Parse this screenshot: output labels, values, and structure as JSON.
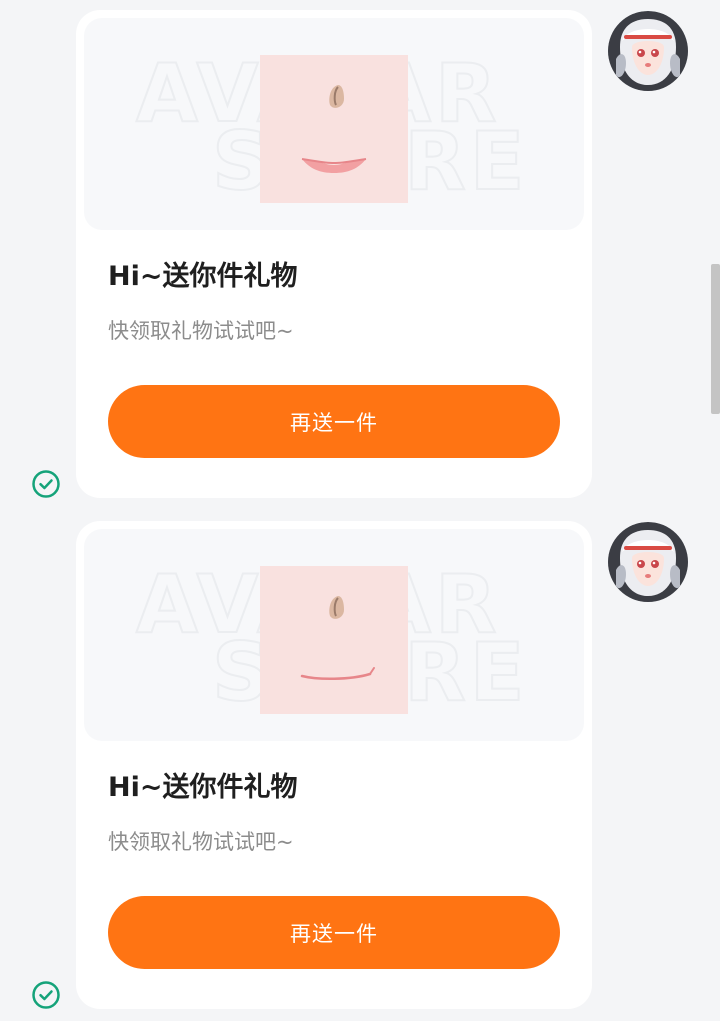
{
  "messages": [
    {
      "gift_watermark": [
        "AVATAR",
        "STORE"
      ],
      "title": "Hi~送你件礼物",
      "subtitle": "快领取礼物试试吧~",
      "button_label": "再送一件",
      "mouth_icon": "smile-mouth",
      "status_icon": "check-circle-icon",
      "avatar_icon": "anime-avatar"
    },
    {
      "gift_watermark": [
        "AVATAR",
        "STORE"
      ],
      "title": "Hi~送你件礼物",
      "subtitle": "快领取礼物试试吧~",
      "button_label": "再送一件",
      "mouth_icon": "thin-smile-mouth",
      "status_icon": "check-circle-icon",
      "avatar_icon": "anime-avatar"
    }
  ],
  "colors": {
    "button": "#ff7413",
    "status_check": "#15a37a",
    "page_background": "#f4f5f7"
  }
}
